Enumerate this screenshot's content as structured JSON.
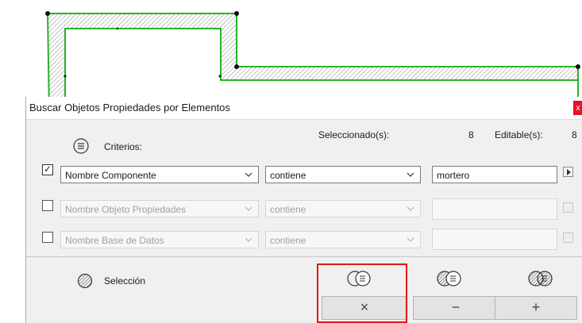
{
  "dialog": {
    "title": "Buscar Objetos Propiedades por Elementos",
    "close_label": "x",
    "criterios_label": "Criterios:",
    "selected_label": "Seleccionado(s):",
    "selected_count": "8",
    "editable_label": "Editable(s):",
    "editable_count": "8",
    "rows": [
      {
        "checked": true,
        "enabled": true,
        "property": "Nombre Componente",
        "operator": "contiene",
        "value": "mortero"
      },
      {
        "checked": false,
        "enabled": false,
        "property": "Nombre Objeto Propiedades",
        "operator": "contiene",
        "value": ""
      },
      {
        "checked": false,
        "enabled": false,
        "property": "Nombre Base de Datos",
        "operator": "contiene",
        "value": ""
      }
    ],
    "seleccion_label": "Selección",
    "actions": {
      "intersect_label": "×",
      "subtract_label": "−",
      "add_label": "+"
    }
  },
  "colors": {
    "wall_outline": "#25b525",
    "highlight": "#e01818",
    "close_red": "#e81123"
  },
  "icons": [
    "list-circle-icon",
    "hatch-icon",
    "intersect-selection-icon",
    "subtract-selection-icon",
    "add-selection-icon",
    "arrow-right-icon",
    "chevron-down-icon",
    "checkmark-icon"
  ]
}
